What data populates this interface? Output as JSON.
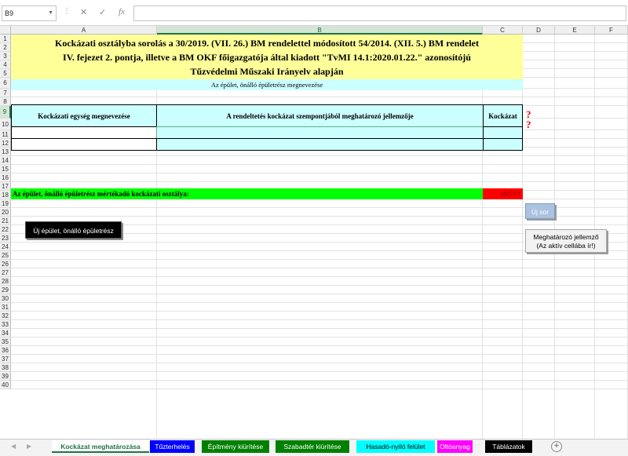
{
  "formula_bar": {
    "name_box": "B9",
    "cancel_icon": "✕",
    "enter_icon": "✓",
    "fx_label": "fx",
    "formula": ""
  },
  "columns": [
    "A",
    "B",
    "C",
    "D",
    "E",
    "F"
  ],
  "rows": [
    "1",
    "2",
    "3",
    "4",
    "5",
    "6",
    "7",
    "8",
    "9",
    "10",
    "11",
    "12",
    "13",
    "14",
    "15",
    "16",
    "17",
    "18",
    "19",
    "20",
    "21",
    "22",
    "23",
    "24",
    "25",
    "26",
    "27",
    "28",
    "29",
    "30",
    "31",
    "32",
    "33",
    "34",
    "35",
    "36",
    "37",
    "38",
    "39",
    "40"
  ],
  "sheet": {
    "title_lines": [
      "Kockázati osztályba sorolás a 30/2019. (VII. 26.) BM rendelettel módosított  54/2014. (XII. 5.) BM rendelet",
      "IV. fejezet 2. pontja, illetve a BM OKF főigazgatója által kiadott \"TvMI 14.1:2020.01.22.\" azonosítójú",
      "Tűzvédelmi Műszaki Irányelv alapján"
    ],
    "subtitle": "Az épület, önálló épületrész megnevezése",
    "header_col_a": "Kockázati egység megnevezése",
    "header_col_b": "A rendeltetés kockázat szempontjából meghatározó jellemzője",
    "header_col_c": "Kockázat",
    "question_mark": "?",
    "result_label": "Az épület, önálló épületrész mértékadó kockázati osztálya:",
    "result_value": "#NÉV?"
  },
  "buttons": {
    "new_building": "Új épület, önálló épületrész",
    "new_row": "Új sor",
    "feature_line1": "Meghatározó jellemző",
    "feature_line2": "(Az aktív cellába ír!)"
  },
  "tabs": [
    {
      "label": "Kockázat meghatározása",
      "bg": "#ffffff",
      "color": "#217346"
    },
    {
      "label": "Tűzterhelés",
      "bg": "#0000ff",
      "color": "#ffffff"
    },
    {
      "label": "Építmény kiürítése",
      "bg": "#008000",
      "color": "#ffffff"
    },
    {
      "label": "Szabadtér kiürítése",
      "bg": "#008000",
      "color": "#ffffff"
    },
    {
      "label": "Hasadó-nyíló felület",
      "bg": "#00ffff",
      "color": "#000000"
    },
    {
      "label": "Oltóanyag",
      "bg": "#ff00ff",
      "color": "#ffffff"
    },
    {
      "label": "Táblázatok",
      "bg": "#000000",
      "color": "#ffffff"
    }
  ],
  "tab_add": "+"
}
